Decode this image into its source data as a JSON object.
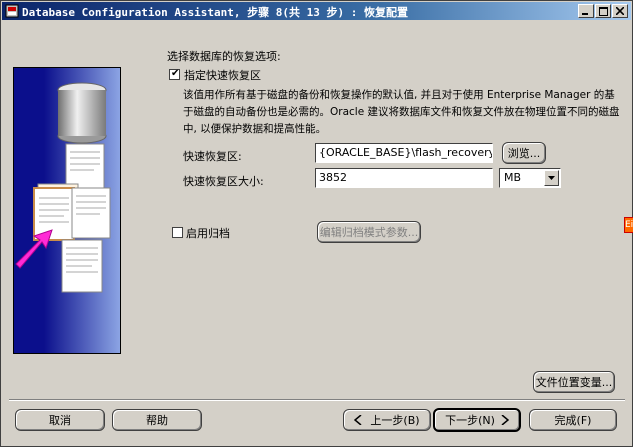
{
  "window": {
    "title": "Database Configuration Assistant, 步骤 8(共 13 步) : 恢复配置",
    "controls": [
      "minimize-icon",
      "maximize-icon",
      "close-icon"
    ]
  },
  "main": {
    "section_label": "选择数据库的恢复选项:",
    "flash_recovery": {
      "checkbox_label": "指定快速恢复区",
      "checked": true,
      "description": "该值用作所有基于磁盘的备份和恢复操作的默认值, 并且对于使用 Enterprise Manager 的基于磁盘的自动备份也是必需的。Oracle 建议将数据库文件和恢复文件放在物理位置不同的磁盘中, 以便保护数据和提高性能。",
      "area_label": "快速恢复区:",
      "area_value": "{ORACLE_BASE}\\flash_recovery_area",
      "browse_label": "浏览...",
      "size_label": "快速恢复区大小:",
      "size_value": "3852",
      "unit_value": "MB"
    },
    "archive": {
      "checkbox_label": "启用归档",
      "checked": false,
      "edit_params_label": "编辑归档模式参数..."
    },
    "file_location_vars_label": "文件位置变量..."
  },
  "footer": {
    "cancel_label": "取消",
    "help_label": "帮助",
    "back_label": "上一步(B)",
    "next_label": "下一步(N)",
    "finish_label": "完成(F)"
  },
  "side_marker": "Ei"
}
